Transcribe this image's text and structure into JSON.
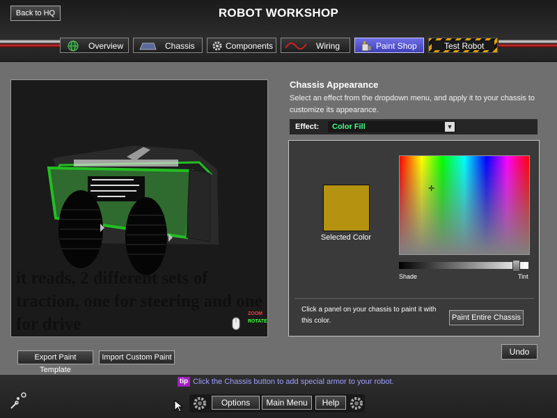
{
  "header": {
    "back_label": "Back to HQ",
    "title": "ROBOT WORKSHOP"
  },
  "tabs": [
    {
      "label": "Overview",
      "icon": "globe-icon"
    },
    {
      "label": "Chassis",
      "icon": "chassis-icon"
    },
    {
      "label": "Components",
      "icon": "gear-icon"
    },
    {
      "label": "Wiring",
      "icon": "wire-icon"
    },
    {
      "label": "Paint Shop",
      "icon": "paint-bucket-icon",
      "active": true
    },
    {
      "label": "Test Robot",
      "icon": "",
      "hazard": true
    }
  ],
  "preview": {
    "robot_text": "it reads, 2 different sets of traction, one for steering and one for drive",
    "zoom_hint": "ZOOM",
    "rotate_hint": "ROTATE"
  },
  "appearance": {
    "title": "Chassis Appearance",
    "description": "Select an effect from the dropdown menu, and apply it to your chassis to customize its appearance.",
    "effect_label": "Effect:",
    "effect_value": "Color Fill",
    "selected_color": "#b5920f",
    "selected_color_label": "Selected Color",
    "shade_label": "Shade",
    "tint_label": "Tint",
    "shade_level": 0.9,
    "paint_help": "Click a panel on your chassis to paint it with this color.",
    "paint_all_label": "Paint Entire Chassis",
    "undo_label": "Undo"
  },
  "bottom_left_buttons": {
    "export_label": "Export Paint Template",
    "import_label": "Import Custom Paint"
  },
  "footer": {
    "tip_tag": "tip",
    "tip_text": "Click the Chassis button to add special armor to your robot.",
    "options_label": "Options",
    "main_menu_label": "Main Menu",
    "help_label": "Help"
  },
  "colors": {
    "active_tab": "#5a5ad8",
    "tip_text": "#a0a0ff",
    "effect_value": "#48ff8a",
    "robot_trim": "#22c022"
  }
}
